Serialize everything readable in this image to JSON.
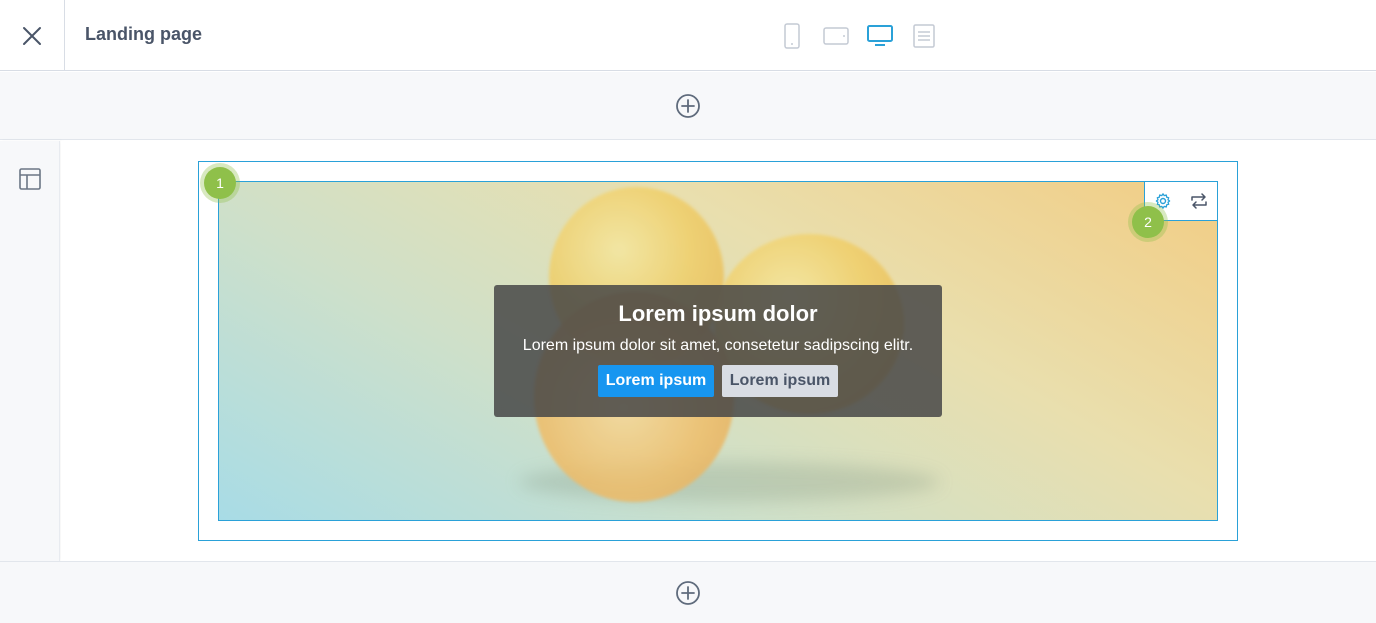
{
  "header": {
    "title": "Landing page",
    "devices": [
      {
        "name": "mobile",
        "active": false
      },
      {
        "name": "tablet",
        "active": false
      },
      {
        "name": "desktop",
        "active": true
      },
      {
        "name": "list",
        "active": false
      }
    ]
  },
  "colors": {
    "accent": "#2aa1d8",
    "icon_inactive": "#c4cad4",
    "badge": "#8fc04a",
    "primary_button": "#1796f0"
  },
  "hero": {
    "title": "Lorem ipsum dolor",
    "text": "Lorem ipsum dolor sit amet, consetetur sadipscing elitr.",
    "primary_button": "Lorem ipsum",
    "secondary_button": "Lorem ipsum"
  },
  "badges": {
    "first": "1",
    "second": "2"
  },
  "icons": {
    "close": "close-icon",
    "add": "plus-circle-icon",
    "layout": "layout-icon",
    "settings": "gear-icon",
    "swap": "swap-icon"
  }
}
